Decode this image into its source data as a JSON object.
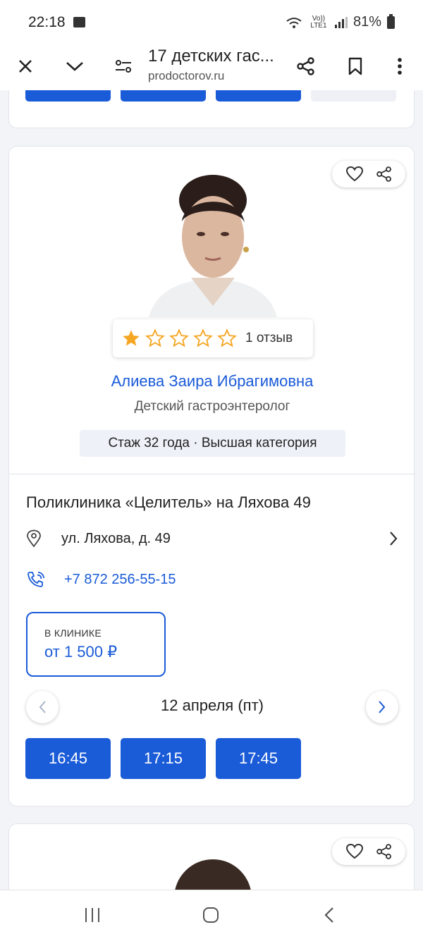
{
  "status_bar": {
    "time": "22:18",
    "network": "Vo)) LTE1",
    "battery": "81%"
  },
  "browser": {
    "page_title": "17 детских гас...",
    "url": "prodoctorov.ru",
    "icons": [
      "close-icon",
      "chevron-down-icon",
      "page-settings-icon",
      "share-icon",
      "bookmark-icon",
      "more-icon"
    ]
  },
  "doctor": {
    "name": "Алиева Заира Ибрагимовна",
    "specialty": "Детский гастроэнтеролог",
    "experience": "Стаж 32 года · Высшая категория",
    "rating": 1,
    "rating_max": 5,
    "reviews": "1 отзыв"
  },
  "clinic": {
    "name": "Поликлиника «Целитель» на Ляхова 49",
    "address": "ул. Ляхова, д. 49",
    "phone": "+7 872 256-55-15"
  },
  "price": {
    "label": "В КЛИНИКЕ",
    "value": "от 1 500 ₽"
  },
  "schedule": {
    "date": "12 апреля (пт)",
    "slots": [
      "16:45",
      "17:15",
      "17:45"
    ]
  },
  "colors": {
    "accent": "#1a5bd8",
    "star": "#f5a623",
    "badge_bg": "#eef1f8"
  }
}
